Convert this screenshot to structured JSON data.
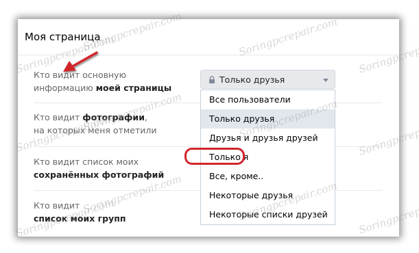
{
  "page": {
    "title": "Моя страница"
  },
  "rows": [
    {
      "line1": "Кто видит основную",
      "line2_normal": "информацию ",
      "line2_bold": "моей страницы"
    },
    {
      "line1_normal": "Кто видит ",
      "line1_bold": "фотографии",
      "line1_tail": ",",
      "line2": "на которых меня отметили"
    },
    {
      "line1": "Кто видит список моих",
      "line2_bold": "сохранённых фотографий"
    },
    {
      "line1": "Кто видит",
      "line2_bold": "список моих групп"
    }
  ],
  "select": {
    "value": "Только друзья",
    "icon": "lock-icon"
  },
  "menu": {
    "items": [
      "Все пользователи",
      "Только друзья",
      "Друзья и друзья друзей",
      "Только я",
      "Все, кроме..",
      "Некоторые друзья",
      "Некоторые списки друзей"
    ],
    "highlighted": "Только друзья",
    "circled": "Только я"
  },
  "annotation": {
    "arrow_color": "#d0262c",
    "circle_color": "#d0262c"
  },
  "watermark": "Soringpcrepair.com"
}
